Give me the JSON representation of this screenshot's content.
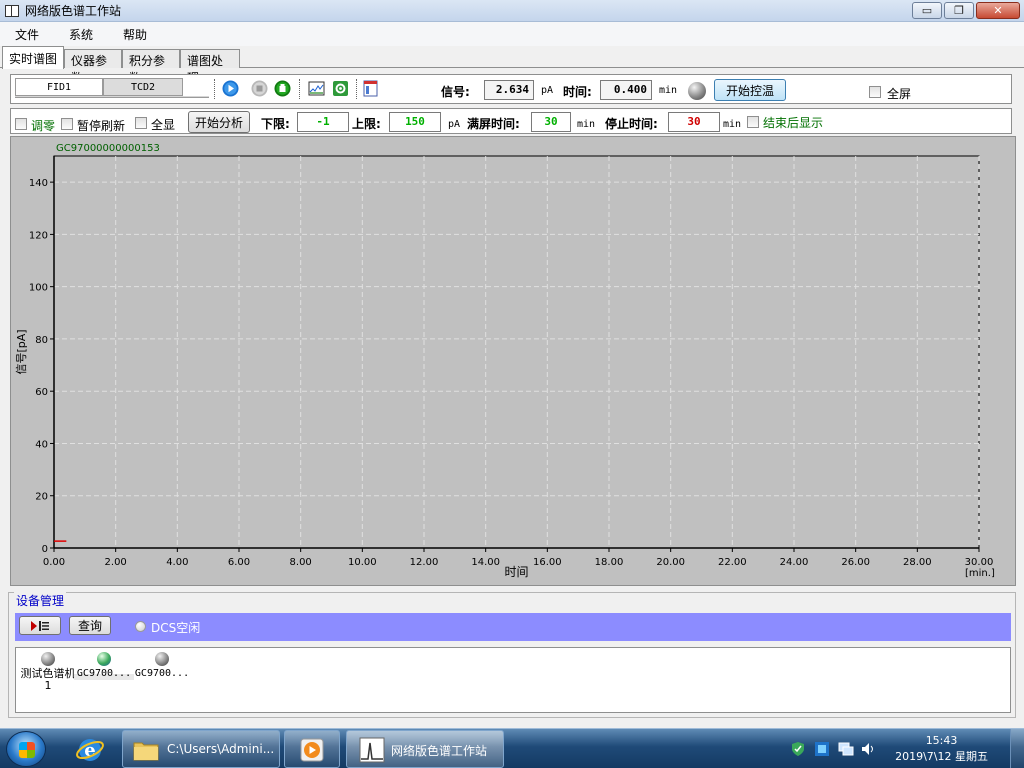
{
  "window": {
    "title": "网络版色谱工作站",
    "minimize": "▭",
    "restore": "❐",
    "close": "✕"
  },
  "menu": [
    "文件",
    "系统",
    "帮助"
  ],
  "tabs": [
    "实时谱图",
    "仪器参数",
    "积分参数",
    "谱图处理"
  ],
  "toolbar": {
    "channels": [
      "FID1",
      "TCD2"
    ],
    "icons": [
      "play-icon",
      "stop-icon",
      "record-icon",
      "chart-icon",
      "settings-icon",
      "report-icon"
    ],
    "signal_label": "信号:",
    "signal_value": "2.634",
    "signal_unit": "pA",
    "time_label": "时间:",
    "time_value": "0.400",
    "time_unit": "min",
    "temp_control_button": "开始控温",
    "fullscreen_label": "全屏"
  },
  "toolbar2": {
    "zero_label": "调零",
    "pause_refresh_label": "暂停刷新",
    "show_all_label": "全显",
    "start_analysis_button": "开始分析",
    "lower_label": "下限:",
    "lower_value": "-1",
    "upper_label": "上限:",
    "upper_value": "150",
    "upper_unit": "pA",
    "screen_time_label": "满屏时间:",
    "screen_time_value": "30",
    "screen_time_unit": "min",
    "stop_time_label": "停止时间:",
    "stop_time_value": "30",
    "stop_time_unit": "min",
    "show_after_label": "结束后显示",
    "colors": {
      "lower": "#00b000",
      "upper": "#00b000",
      "screen": "#00b000",
      "stop": "#d00000",
      "show_after": "#007000"
    }
  },
  "chart_data": {
    "type": "line",
    "title": "GC97000000000153",
    "xlabel": "时间",
    "xunit": "[min.]",
    "ylabel": "信号[pA]",
    "xlim": [
      0,
      30
    ],
    "ylim": [
      0,
      150
    ],
    "xticks": [
      "0.00",
      "2.00",
      "4.00",
      "6.00",
      "8.00",
      "10.00",
      "12.00",
      "14.00",
      "16.00",
      "18.00",
      "20.00",
      "22.00",
      "24.00",
      "26.00",
      "28.00",
      "30.00"
    ],
    "yticks": [
      "0",
      "20",
      "40",
      "60",
      "80",
      "100",
      "120",
      "140"
    ],
    "grid": true,
    "series": [
      {
        "x": [
          0,
          0.1,
          0.2,
          0.3,
          0.4
        ],
        "y": [
          2.63,
          2.63,
          2.63,
          2.63,
          2.63
        ],
        "color": "#e00000"
      }
    ],
    "plot_bg": "#c0c0c0"
  },
  "device_management": {
    "title": "设备管理",
    "query_button": "查询",
    "dcs_status": "DCS空闲",
    "devices": [
      {
        "name": "测试色谱机1",
        "status": "gray"
      },
      {
        "name": "GC9700...",
        "status": "active"
      },
      {
        "name": "GC9700...",
        "status": "gray"
      }
    ]
  },
  "taskbar": {
    "apps": [
      {
        "icon": "ie-icon",
        "label": ""
      },
      {
        "icon": "folder-icon",
        "label": "C:\\Users\\Admini..."
      },
      {
        "icon": "media-icon",
        "label": ""
      },
      {
        "icon": "chromatogram-icon",
        "label": "网络版色谱工作站"
      }
    ],
    "time": "15:43",
    "date": "2019\\7\\12 星期五"
  }
}
